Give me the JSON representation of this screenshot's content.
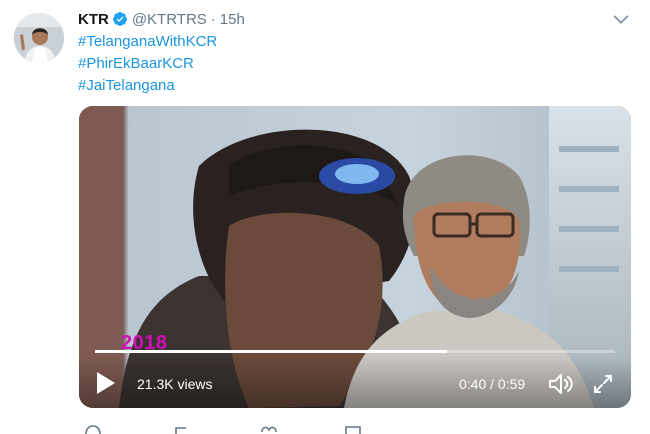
{
  "tweet": {
    "name": "KTR",
    "handle": "@KTRTRS",
    "separator": "·",
    "time": "15h",
    "hashtags": [
      "#TelanganaWithKCR",
      "#PhirEkBaarKCR",
      "#JaiTelangana"
    ]
  },
  "video": {
    "overlay_text": "2018",
    "views": "21.3K views",
    "timecode": "0:40 / 0:59",
    "progress_fraction": 0.677
  },
  "icons": {
    "verified": "verified-badge-icon",
    "menu": "chevron-down-icon",
    "play": "play-icon",
    "volume": "volume-icon",
    "fullscreen": "fullscreen-icon"
  },
  "colors": {
    "link": "#1b95e0",
    "verified": "#1da1f2",
    "overlay_text": "#d10fb8"
  }
}
